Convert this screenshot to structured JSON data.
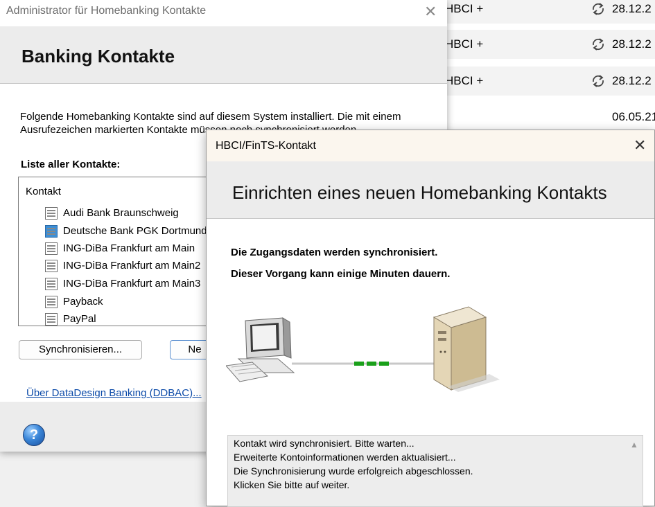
{
  "background_list": {
    "rows": [
      {
        "type": "HBCI +",
        "date": "28.12.2",
        "synced": true
      },
      {
        "type": "HBCI +",
        "date": "28.12.2",
        "synced": true
      },
      {
        "type": "HBCI +",
        "date": "28.12.2",
        "synced": true
      },
      {
        "type": "",
        "date": "06.05.21",
        "synced": false
      }
    ]
  },
  "admin_window": {
    "title": "Administrator für Homebanking Kontakte",
    "close_glyph": "✕",
    "header_title": "Banking Kontakte",
    "description": "Folgende Homebanking Kontakte sind auf diesem System installiert. Die mit einem Ausrufezeichen markierten Kontakte müssen noch synchronisiert werden.",
    "list_label": "Liste aller Kontakte:",
    "list_header": "Kontakt",
    "contacts": [
      {
        "label": "Audi Bank Braunschweig",
        "selected": false
      },
      {
        "label": "Deutsche Bank PGK Dortmund",
        "selected": true
      },
      {
        "label": "ING-DiBa Frankfurt am Main",
        "selected": false
      },
      {
        "label": "ING-DiBa Frankfurt am Main2",
        "selected": false
      },
      {
        "label": "ING-DiBa Frankfurt am Main3",
        "selected": false
      },
      {
        "label": "Payback",
        "selected": false
      },
      {
        "label": "PayPal",
        "selected": false
      }
    ],
    "sync_button": "Synchronisieren...",
    "new_button": "Ne",
    "about_link": "Über DataDesign Banking (DDBAC)...",
    "help_glyph": "?"
  },
  "hbci_dialog": {
    "title": "HBCI/FinTS-Kontakt",
    "close_glyph": "✕",
    "header_title": "Einrichten eines neuen Homebanking Kontakts",
    "message_line1": "Die Zugangsdaten werden synchronisiert.",
    "message_line2": "Dieser Vorgang kann einige Minuten dauern.",
    "connection_icons": [
      "computer-icon",
      "server-icon"
    ],
    "status_log": [
      "Kontakt wird synchronisiert. Bitte warten...",
      "Erweiterte Kontoinformationen werden aktualisiert...",
      "Die Synchronisierung wurde erfolgreich abgeschlossen.",
      "Klicken Sie bitte auf weiter."
    ],
    "scroll_up_glyph": "▲"
  },
  "colors": {
    "link": "#0b4aa8",
    "selection": "#3d8fd6",
    "progress": "#1aa01a",
    "header_bg": "#ececec"
  }
}
